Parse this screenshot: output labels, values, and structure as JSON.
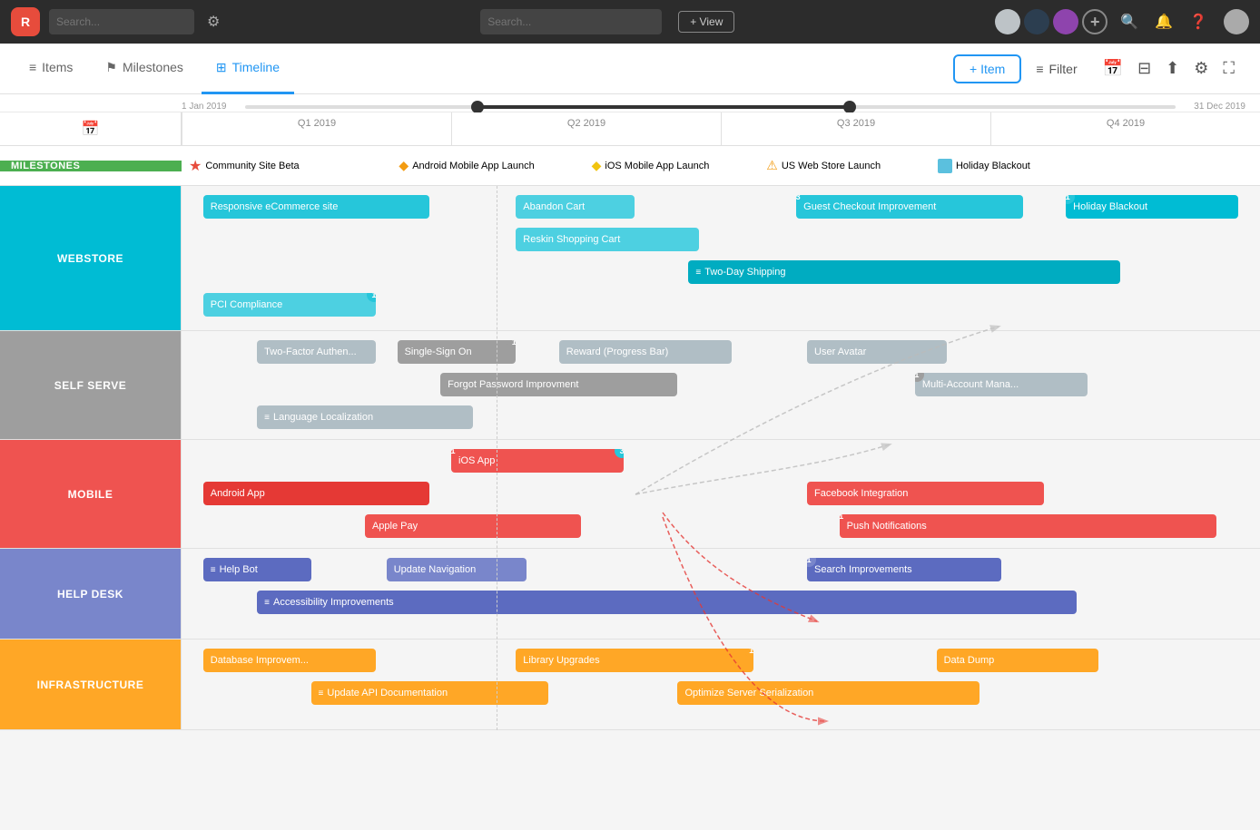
{
  "topNav": {
    "logo": "R",
    "searchPlaceholder": "Search...",
    "centerSearchPlaceholder": "Search...",
    "viewLabel": "+ View"
  },
  "tabs": [
    {
      "id": "items",
      "label": "Items",
      "icon": "≡",
      "active": false
    },
    {
      "id": "milestones",
      "label": "Milestones",
      "icon": "⚑",
      "active": false
    },
    {
      "id": "timeline",
      "label": "Timeline",
      "icon": "⊞",
      "active": true
    }
  ],
  "toolbar": {
    "addItem": "+ Item",
    "filter": "Filter"
  },
  "timeline": {
    "startDate": "1 Jan 2019",
    "endDate": "31 Dec 2019",
    "quarters": [
      "Q1 2019",
      "Q2 2019",
      "Q3 2019",
      "Q4 2019"
    ]
  },
  "milestones": {
    "label": "MILESTONES",
    "items": [
      {
        "icon": "star",
        "label": "Community Site Beta"
      },
      {
        "icon": "diamond-orange",
        "label": "Android Mobile App Launch"
      },
      {
        "icon": "diamond-yellow",
        "label": "iOS Mobile App Launch"
      },
      {
        "icon": "warning",
        "label": "US Web Store Launch"
      },
      {
        "icon": "box",
        "label": "Holiday Blackout"
      }
    ]
  },
  "sections": [
    {
      "id": "webstore",
      "label": "WEBSTORE",
      "colorClass": "webstore-color",
      "rows": [
        [
          {
            "label": "Responsive eCommerce site",
            "colorClass": "bar-teal",
            "left": "2%",
            "width": "21%"
          },
          {
            "label": "Abandon Cart",
            "colorClass": "bar-teal-light",
            "left": "31%",
            "width": "11%"
          },
          {
            "label": "Guest Checkout Improvement",
            "colorClass": "bar-teal",
            "left": "58%",
            "width": "20%",
            "badge": "3"
          },
          {
            "label": "Holiday Blackout",
            "colorClass": "bar-teal-bright",
            "left": "82%",
            "width": "16%",
            "badge": "1"
          }
        ],
        [
          {
            "label": "Reskin Shopping Cart",
            "colorClass": "bar-teal-light",
            "left": "31%",
            "width": "17%"
          }
        ],
        [
          {
            "label": "Two-Day Shipping",
            "colorClass": "bar-teal-dark",
            "left": "48%",
            "width": "38%",
            "icon": "≡"
          }
        ],
        [
          {
            "label": "PCI Compliance",
            "colorClass": "bar-teal-light",
            "left": "2%",
            "width": "16%",
            "badge": "1"
          }
        ]
      ]
    },
    {
      "id": "selfserve",
      "label": "SELF SERVE",
      "colorClass": "selfserve-color",
      "rows": [
        [
          {
            "label": "Two-Factor Authen...",
            "colorClass": "bar-gray-light",
            "left": "7%",
            "width": "11%"
          },
          {
            "label": "Single-Sign On",
            "colorClass": "bar-gray",
            "left": "20%",
            "width": "11%",
            "badge": "1"
          },
          {
            "label": "Reward (Progress Bar)",
            "colorClass": "bar-gray-light",
            "left": "35%",
            "width": "16%"
          },
          {
            "label": "User Avatar",
            "colorClass": "bar-gray-light",
            "left": "56%",
            "width": "12%"
          }
        ],
        [
          {
            "label": "Forgot Password Improvment",
            "colorClass": "bar-gray",
            "left": "24%",
            "width": "22%"
          },
          {
            "label": "Multi-Account Mana...",
            "colorClass": "bar-gray-light",
            "left": "68%",
            "width": "15%",
            "badge": "1"
          }
        ],
        [
          {
            "label": "Language Localization",
            "colorClass": "bar-gray-light",
            "left": "7%",
            "width": "19%",
            "icon": "≡"
          }
        ]
      ]
    },
    {
      "id": "mobile",
      "label": "MOBILE",
      "colorClass": "mobile-color",
      "rows": [
        [
          {
            "label": "iOS App",
            "colorClass": "bar-red",
            "left": "25%",
            "width": "15%",
            "badge-left": "1",
            "badge-right": "3"
          }
        ],
        [
          {
            "label": "Android App",
            "colorClass": "bar-red-dark",
            "left": "2%",
            "width": "21%"
          },
          {
            "label": "Facebook Integration",
            "colorClass": "bar-red",
            "left": "57%",
            "width": "22%"
          }
        ],
        [
          {
            "label": "Apple Pay",
            "colorClass": "bar-red",
            "left": "17%",
            "width": "20%"
          },
          {
            "label": "Push Notifications",
            "colorClass": "bar-red",
            "left": "62%",
            "width": "34%",
            "badge": "1"
          }
        ]
      ]
    },
    {
      "id": "helpdesk",
      "label": "HELP DESK",
      "colorClass": "helpdesk-color",
      "rows": [
        [
          {
            "label": "Help Bot",
            "colorClass": "bar-blue",
            "left": "2%",
            "width": "10%",
            "icon": "≡"
          },
          {
            "label": "Update Navigation",
            "colorClass": "bar-blue-light",
            "left": "19%",
            "width": "13%"
          },
          {
            "label": "Search Improvements",
            "colorClass": "bar-blue",
            "left": "58%",
            "width": "18%",
            "badge": "1"
          }
        ],
        [
          {
            "label": "Accessibility Improvements",
            "colorClass": "bar-blue",
            "left": "7%",
            "width": "75%",
            "icon": "≡"
          }
        ]
      ]
    },
    {
      "id": "infrastructure",
      "label": "INFRASTRUCTURE",
      "colorClass": "infra-color",
      "rows": [
        [
          {
            "label": "Database Improvem...",
            "colorClass": "bar-orange",
            "left": "2%",
            "width": "16%"
          },
          {
            "label": "Library Upgrades",
            "colorClass": "bar-orange",
            "left": "31%",
            "width": "21%",
            "badge": "1"
          },
          {
            "label": "Data Dump",
            "colorClass": "bar-orange",
            "left": "70%",
            "width": "15%"
          }
        ],
        [
          {
            "label": "Update API Documentation",
            "colorClass": "bar-orange",
            "left": "12%",
            "width": "22%",
            "icon": "≡"
          },
          {
            "label": "Optimize Server Serialization",
            "colorClass": "bar-orange",
            "left": "46%",
            "width": "28%"
          }
        ]
      ]
    }
  ]
}
